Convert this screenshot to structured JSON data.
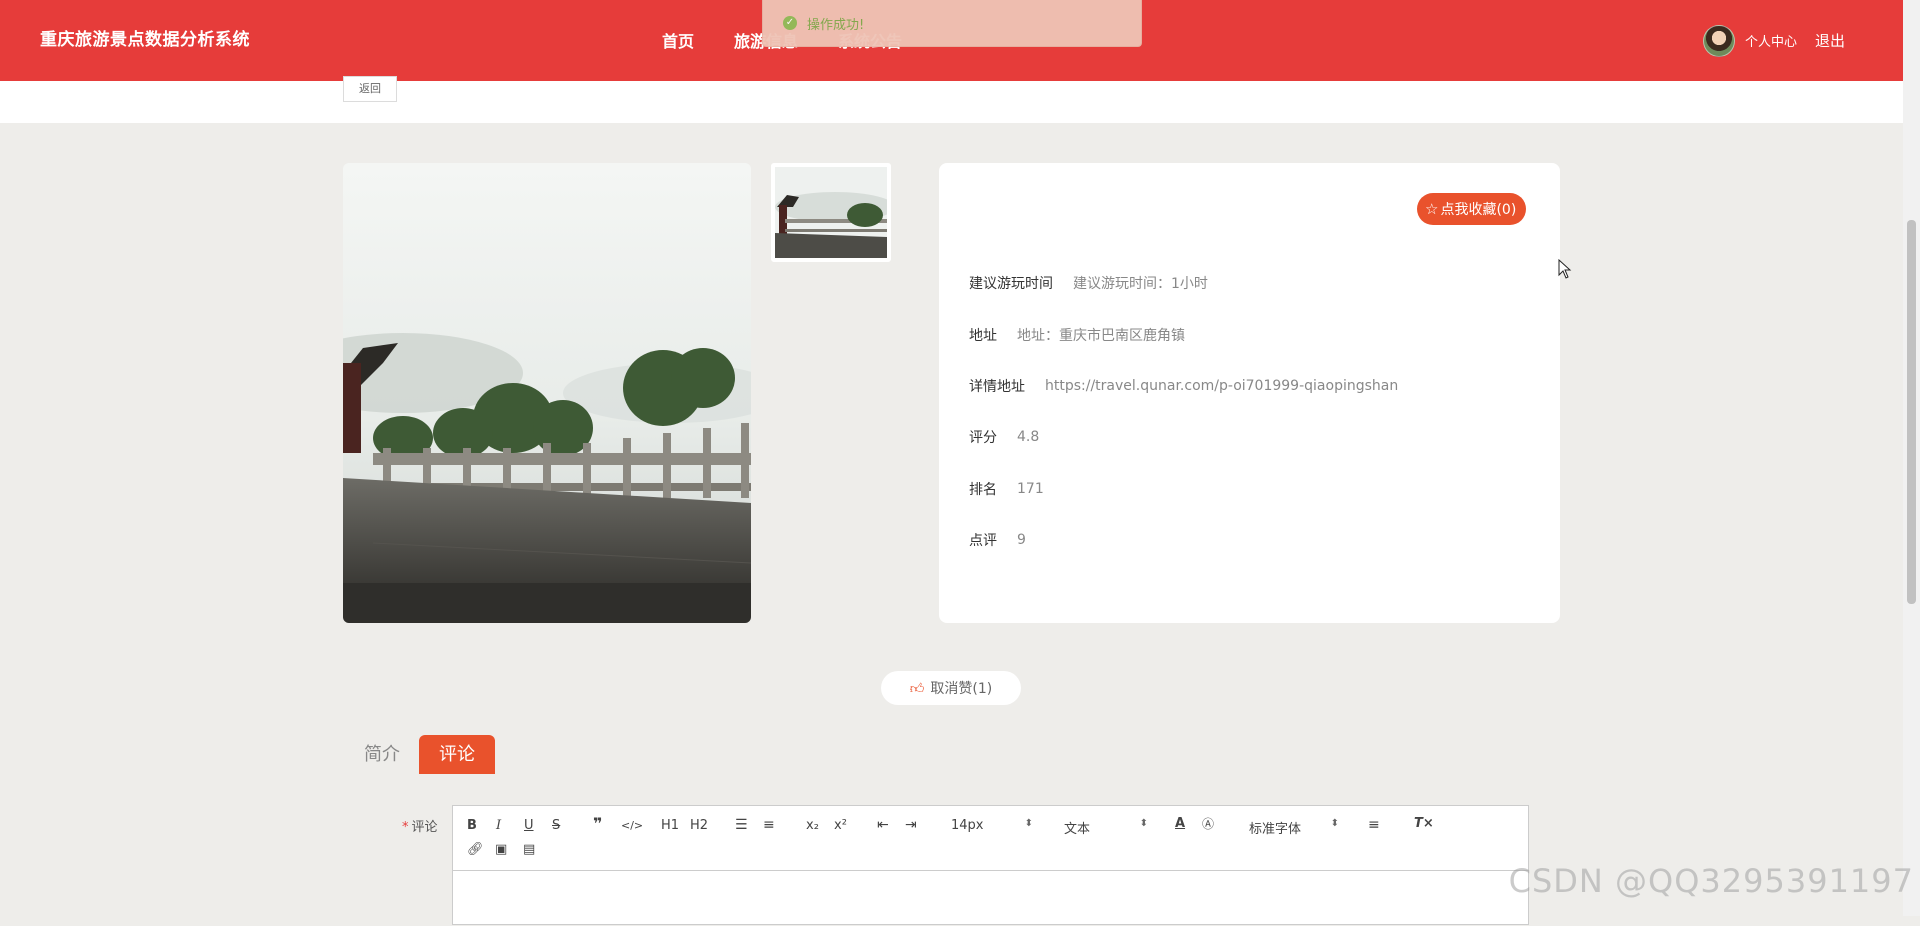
{
  "brand": "重庆旅游景点数据分析系统",
  "nav": [
    "首页",
    "旅游信息",
    "系统公告"
  ],
  "user": {
    "center": "个人中心",
    "logout": "退出"
  },
  "toast": "操作成功!",
  "back": "返回",
  "favorite": "点我收藏(0)",
  "details": [
    {
      "label": "建议游玩时间",
      "value": "建议游玩时间：1小时"
    },
    {
      "label": "地址",
      "value": "地址：重庆市巴南区鹿角镇"
    },
    {
      "label": "详情地址",
      "value": "https://travel.qunar.com/p-oi701999-qiaopingshan"
    },
    {
      "label": "评分",
      "value": "4.8"
    },
    {
      "label": "排名",
      "value": "171"
    },
    {
      "label": "点评",
      "value": "9"
    }
  ],
  "like": "取消赞(1)",
  "tabs": [
    "简介",
    "评论"
  ],
  "form": {
    "label": "评论",
    "required_mark": "*",
    "toolbar": {
      "bold": "B",
      "italic": "I",
      "underline": "U",
      "strike": "S",
      "h1": "H1",
      "h2": "H2",
      "sub": "x₂",
      "sup": "x²",
      "size": "14px",
      "header": "文本",
      "font": "标准字体"
    }
  },
  "watermark": "CSDN @QQ3295391197",
  "colors": {
    "brand_red": "#e63c3a",
    "accent_orange": "#e9522c"
  }
}
